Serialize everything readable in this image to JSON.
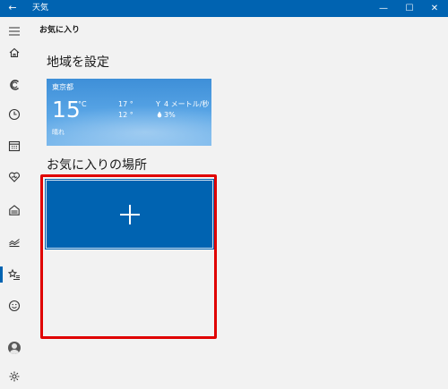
{
  "window": {
    "back_glyph": "←",
    "title": "天気",
    "minimize_glyph": "—",
    "maximize_glyph": "☐",
    "close_glyph": "✕"
  },
  "page": {
    "title": "お気に入り"
  },
  "sections": {
    "home": "地域を設定",
    "favorites": "お気に入りの場所"
  },
  "home_tile": {
    "city": "東京都",
    "temperature": "15",
    "unit": "°C",
    "condition": "晴れ",
    "high": "17 °",
    "low": "12 °",
    "wind_icon": "Y",
    "wind": "4 メートル/秒",
    "rain_icon": "💧",
    "precip": "3%"
  },
  "nav": {
    "items": [
      {
        "name": "hamburger-menu-icon"
      },
      {
        "name": "home-icon"
      },
      {
        "name": "news-icon"
      },
      {
        "name": "clock-icon"
      },
      {
        "name": "calendar-icon"
      },
      {
        "name": "heart-icon"
      },
      {
        "name": "house-icon"
      },
      {
        "name": "chart-icon"
      },
      {
        "name": "favorites-icon",
        "active": true
      },
      {
        "name": "smiley-icon"
      },
      {
        "name": "user-avatar-icon"
      },
      {
        "name": "settings-gear-icon"
      }
    ]
  },
  "colors": {
    "accent": "#0063b1",
    "highlight": "#e00000",
    "background": "#f2f2f2"
  }
}
